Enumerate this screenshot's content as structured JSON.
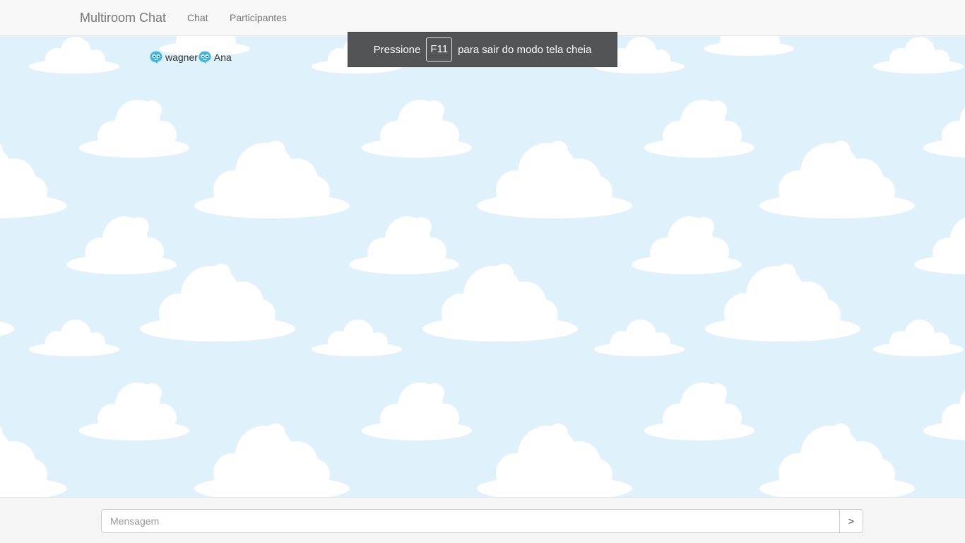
{
  "navbar": {
    "brand": "Multiroom Chat",
    "links": [
      {
        "label": "Chat"
      },
      {
        "label": "Participantes"
      }
    ]
  },
  "participants": [
    {
      "name": "wagner",
      "icon": "chat-bubble-face-icon"
    },
    {
      "name": "Ana",
      "icon": "chat-bubble-face-icon"
    }
  ],
  "fullscreen_notice": {
    "prefix": "Pressione",
    "key": "F11",
    "suffix": "para sair do modo tela cheia"
  },
  "composer": {
    "placeholder": "Mensagem",
    "value": "",
    "send_label": ">"
  },
  "colors": {
    "sky": "#dff2fb",
    "cloud": "#ffffff",
    "icon": "#3cb6e3"
  }
}
